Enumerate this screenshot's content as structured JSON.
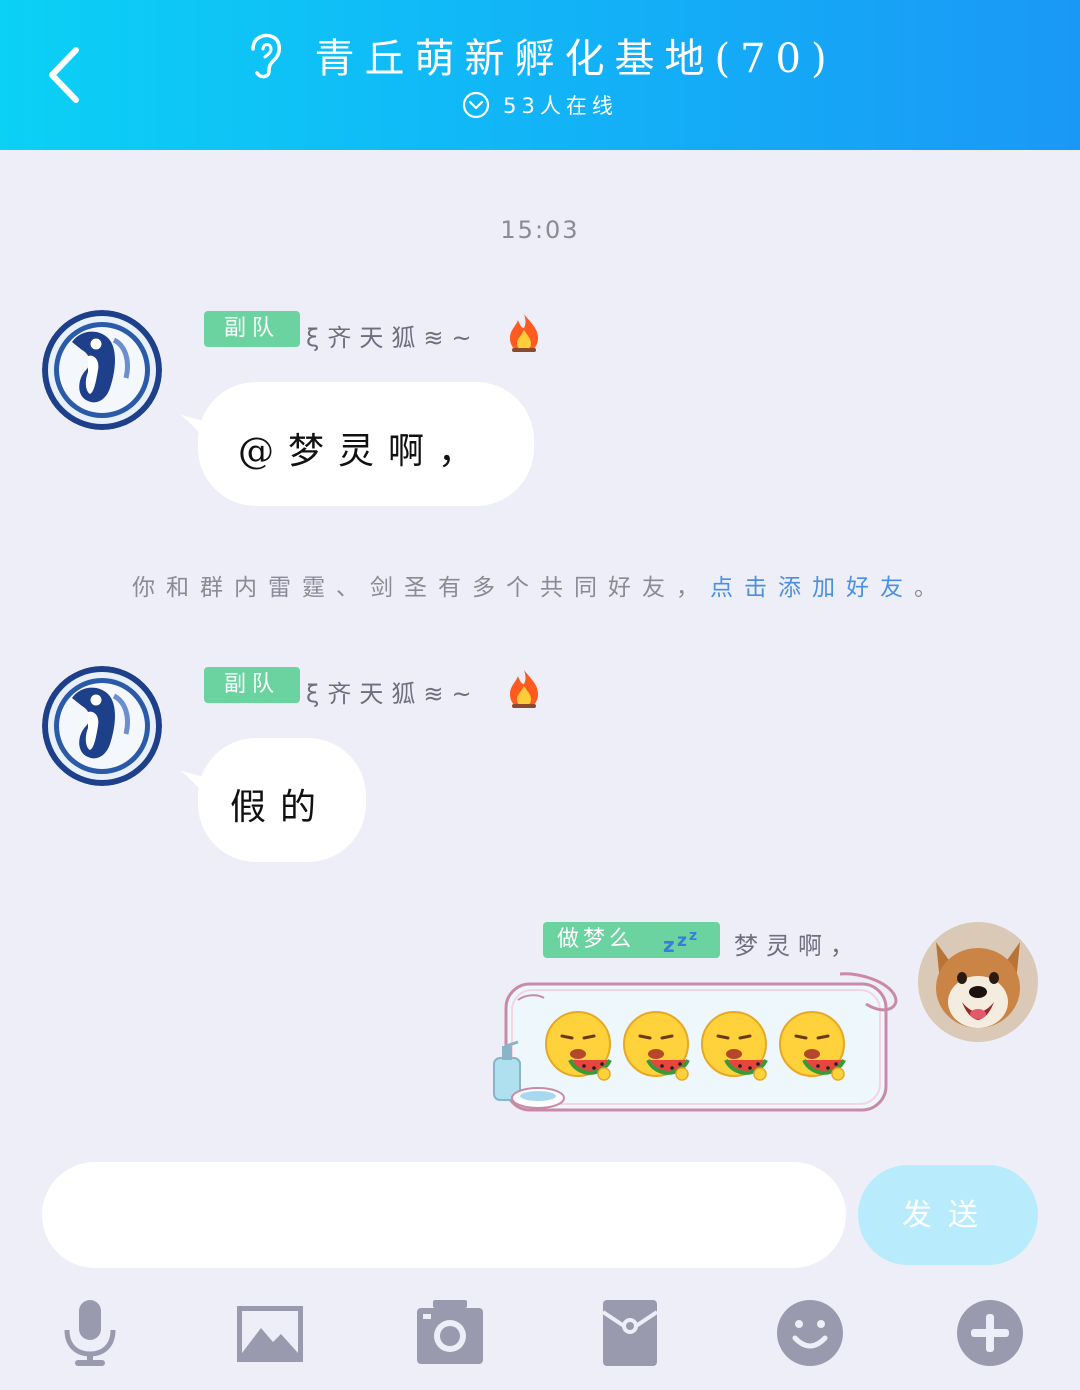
{
  "header": {
    "title": "青丘萌新孵化基地(70)",
    "online": "53人在线"
  },
  "chat": {
    "timestamp": "15:03",
    "messages": [
      {
        "tag": "副队",
        "sender": "ξ齐天狐≋~",
        "text": "@梦灵啊，"
      },
      {
        "tag": "副队",
        "sender": "ξ齐天狐≋~",
        "text": "假的"
      }
    ],
    "notice": {
      "text": "你和群内雷霆、剑圣有多个共同好友，",
      "link": "点击添加好友",
      "end": "。"
    },
    "self_message": {
      "tag": "做梦么",
      "sender": "梦灵啊，",
      "emoji_count": 4
    }
  },
  "input": {
    "placeholder": "",
    "send_label": "发送"
  },
  "colors": {
    "header_start": "#0bd1f5",
    "header_end": "#1a98f6",
    "tag_green": "#6bd39f",
    "link_blue": "#4a90e2",
    "send_button": "#b8ebfb",
    "tool_icon": "#9a9aae"
  },
  "toolbar": {
    "icons": [
      "microphone-icon",
      "image-icon",
      "camera-icon",
      "red-packet-icon",
      "emoji-icon",
      "plus-icon"
    ]
  }
}
